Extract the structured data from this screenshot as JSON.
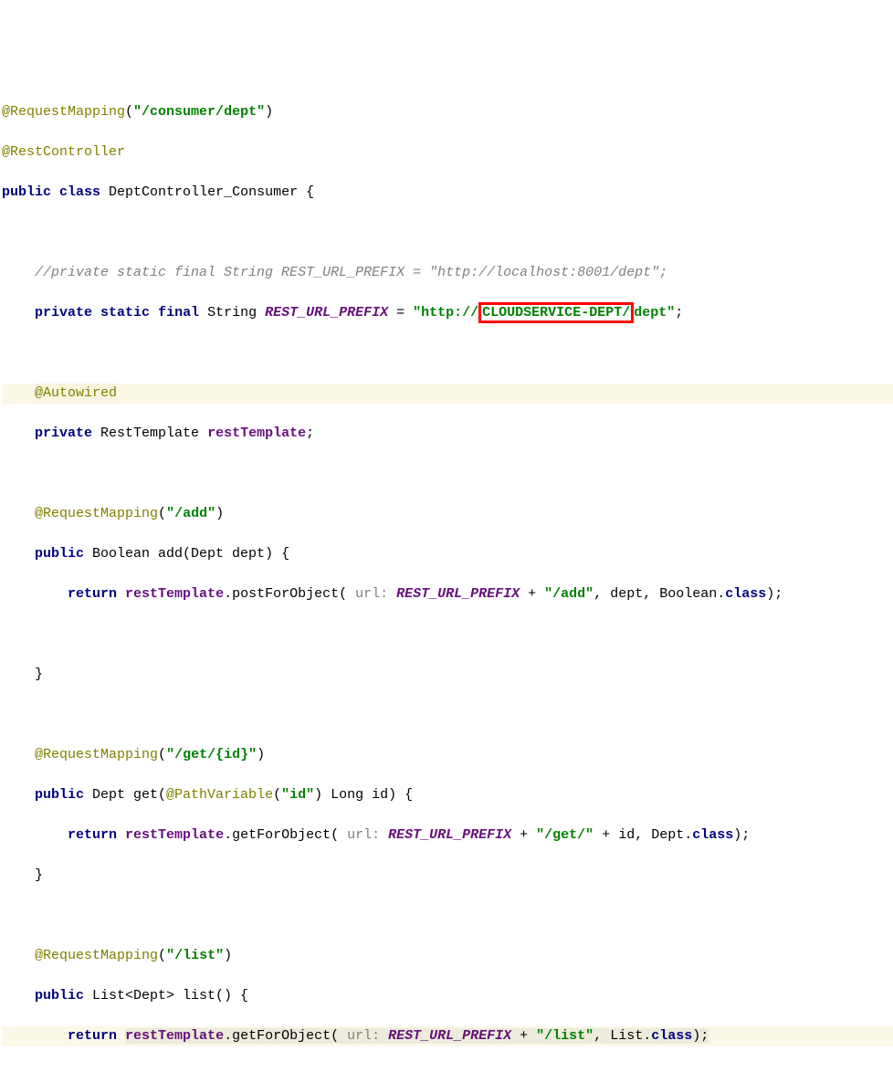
{
  "code": {
    "line1_anno": "@RequestMapping",
    "line1_paren_open": "(",
    "line1_str": "\"/consumer/dept\"",
    "line1_paren_close": ")",
    "line2_anno": "@RestController",
    "line3_kw1": "public",
    "line3_kw2": "class",
    "line3_name": " DeptController_Consumer {",
    "line5_comment": "//private static final String REST_URL_PREFIX = \"http://localhost:8001/dept\";",
    "line6_kw1": "private",
    "line6_kw2": "static",
    "line6_kw3": "final",
    "line6_type": " String ",
    "line6_const": "REST_URL_PREFIX",
    "line6_eq": " = ",
    "line6_str1": "\"http://",
    "line6_box": "CLOUDSERVICE-DEPT/",
    "line6_str2": "dept\"",
    "line6_semi": ";",
    "line8_anno": "@Autowired",
    "line9_kw": "private",
    "line9_type": " RestTemplate ",
    "line9_field": "restTemplate",
    "line9_semi": ";",
    "line11_anno": "@RequestMapping",
    "line11_str": "\"/add\"",
    "line12_kw": "public",
    "line12_sig": " Boolean add(Dept dept) {",
    "line13_kw": "return",
    "line13_field": "restTemplate",
    "line13_call": ".postForObject(",
    "line13_hint": " url: ",
    "line13_const": "REST_URL_PREFIX",
    "line13_plus": " + ",
    "line13_str": "\"/add\"",
    "line13_rest": ", dept, Boolean.",
    "line13_kw2": "class",
    "line13_end": ");",
    "line15_brace": "}",
    "line17_anno": "@RequestMapping",
    "line17_str": "\"/get/{id}\"",
    "line18_kw": "public",
    "line18_sig1": " Dept get(",
    "line18_anno": "@PathVariable",
    "line18_pv_open": "(",
    "line18_pv_str": "\"id\"",
    "line18_pv_close": ")",
    "line18_sig2": " Long id) {",
    "line19_kw": "return",
    "line19_field": "restTemplate",
    "line19_call": ".getForObject(",
    "line19_hint": " url: ",
    "line19_const": "REST_URL_PREFIX",
    "line19_plus": " + ",
    "line19_str": "\"/get/\"",
    "line19_rest": " + id, Dept.",
    "line19_kw2": "class",
    "line19_end": ");",
    "line20_brace": "}",
    "line22_anno": "@RequestMapping",
    "line22_str": "\"/list\"",
    "line23_kw": "public",
    "line23_sig": " List<Dept> list() {",
    "line24_kw": "return",
    "line24_field": "restTemplate",
    "line24_call": ".getForObject(",
    "line24_hint": " url: ",
    "line24_const": "REST_URL_PREFIX",
    "line24_plus": " + ",
    "line24_str": "\"/list\"",
    "line24_rest": ", List.",
    "line24_kw2": "class",
    "line24_end": ");"
  }
}
